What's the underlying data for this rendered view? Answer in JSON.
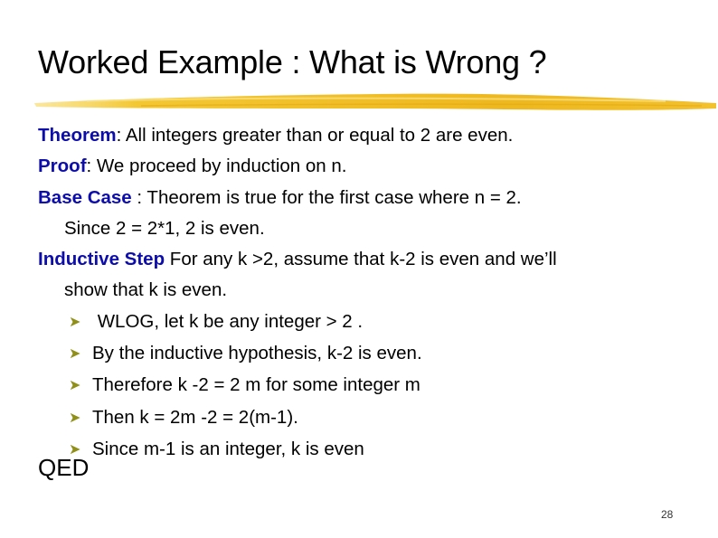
{
  "slide": {
    "title": "Worked Example : What is Wrong ?",
    "accent_color": "#f2c12e",
    "keyword_color": "#0d0dac",
    "bullet_icon": "arrow-bullet-icon",
    "lines": {
      "theorem_label": "Theorem",
      "theorem_text": ": All integers greater than or equal to 2 are even.",
      "proof_label": "Proof",
      "proof_text": ":  We proceed by induction on n.",
      "base_label": "Base Case",
      "base_text": " : Theorem is true for the first case where n = 2.",
      "base_cont": "Since  2 = 2*1,  2 is even.",
      "inductive_label": "Inductive Step",
      "inductive_text": " For  any k >2,  assume that k-2 is even and we’ll",
      "inductive_cont": "show that k is even."
    },
    "bullets": [
      " WLOG, let k be any integer > 2 .",
      "By the inductive hypothesis, k-2 is even.",
      "Therefore  k -2  = 2 m   for some integer m",
      "Then   k = 2m -2  =  2(m-1).",
      "Since m-1 is an integer,  k is even"
    ],
    "qed": "QED",
    "page_number": "28"
  }
}
